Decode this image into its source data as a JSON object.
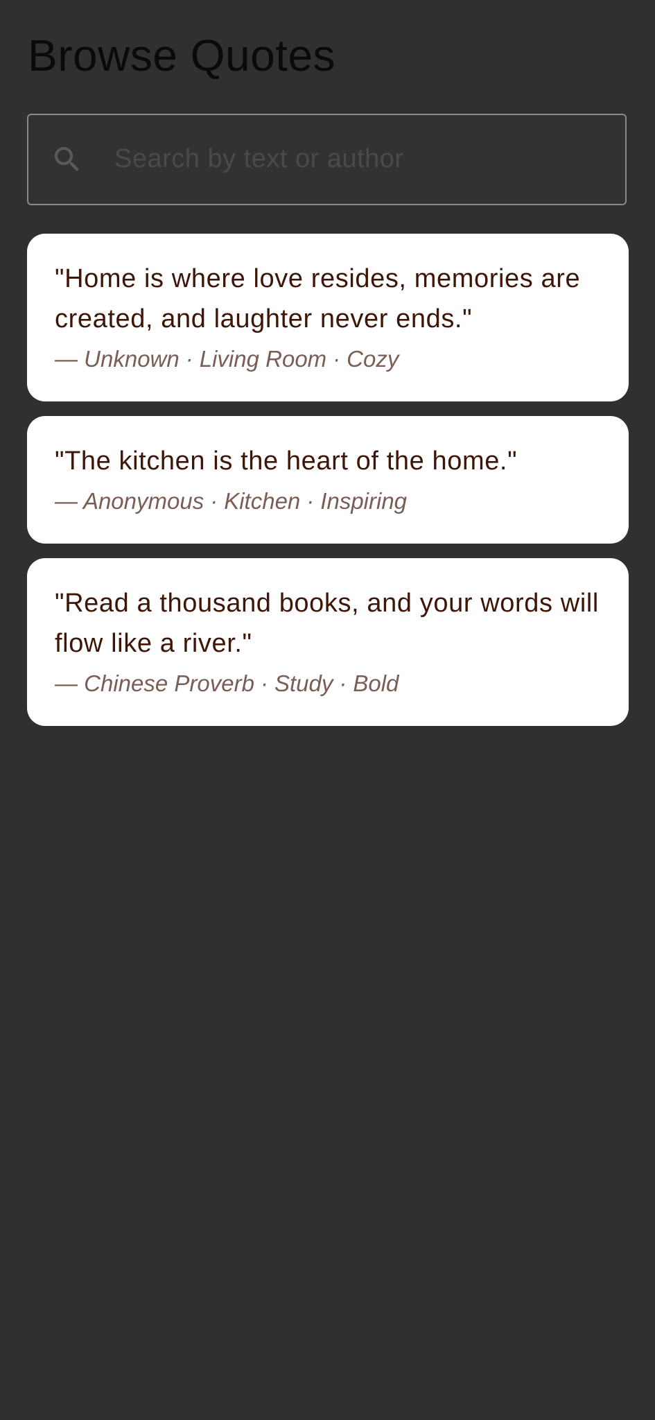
{
  "page": {
    "title": "Browse Quotes"
  },
  "search": {
    "placeholder": "Search by text or author",
    "value": "",
    "icon": "search-icon"
  },
  "quotes": [
    {
      "text": "\"Home is where love resides, memories are created, and laughter never ends.\"",
      "author": "— Unknown",
      "room": "Living Room",
      "mood": "Cozy"
    },
    {
      "text": "\"The kitchen is the heart of the home.\"",
      "author": "— Anonymous",
      "room": "Kitchen",
      "mood": "Inspiring"
    },
    {
      "text": "\"Read a thousand books, and your words will flow like a river.\"",
      "author": "— Chinese Proverb",
      "room": "Study",
      "mood": "Bold"
    }
  ],
  "meta_separator": "·",
  "colors": {
    "background": "#303030",
    "card": "#ffffff",
    "quote_text": "#3e1608",
    "meta_text": "#7a5e55",
    "search_border": "#8a8a8e"
  }
}
